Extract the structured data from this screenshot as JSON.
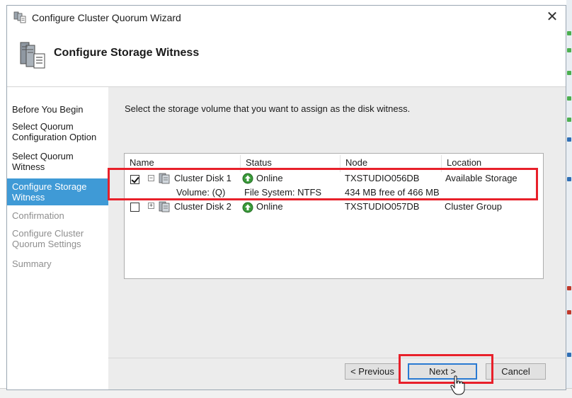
{
  "window": {
    "title": "Configure Cluster Quorum Wizard"
  },
  "header": {
    "title": "Configure Storage Witness"
  },
  "nav": {
    "items": [
      {
        "label": "Before You Begin",
        "state": "normal"
      },
      {
        "label": "Select Quorum Configuration Option",
        "state": "normal"
      },
      {
        "label": "Select Quorum Witness",
        "state": "normal"
      },
      {
        "label": "Configure Storage Witness",
        "state": "active"
      },
      {
        "label": "Confirmation",
        "state": "disabled"
      },
      {
        "label": "Configure Cluster Quorum Settings",
        "state": "disabled"
      },
      {
        "label": "Summary",
        "state": "disabled"
      }
    ]
  },
  "content": {
    "instruction": "Select the storage volume that you want to assign as the disk witness."
  },
  "table": {
    "columns": [
      "Name",
      "Status",
      "Node",
      "Location"
    ],
    "rows": [
      {
        "checked": true,
        "expanded": true,
        "expander": "−",
        "name": "Cluster Disk 1",
        "status": "Online",
        "node": "TXSTUDIO056DB",
        "location": "Available Storage",
        "sub": {
          "name": "Volume: (Q)",
          "status": "File System: NTFS",
          "node": "434 MB free of 466 MB"
        }
      },
      {
        "checked": false,
        "expanded": false,
        "expander": "+",
        "name": "Cluster Disk 2",
        "status": "Online",
        "node": "TXSTUDIO057DB",
        "location": "Cluster Group"
      }
    ]
  },
  "buttons": {
    "previous": "< Previous",
    "next": "Next >",
    "cancel": "Cancel"
  },
  "colors": {
    "accent": "#3f9ad6",
    "highlight": "#e8202a",
    "online": "#3a9a3a"
  },
  "icons": [
    "cluster-app-icon",
    "storage-witness-icon",
    "disk-icon",
    "online-status-icon",
    "close-icon",
    "mouse-cursor"
  ]
}
